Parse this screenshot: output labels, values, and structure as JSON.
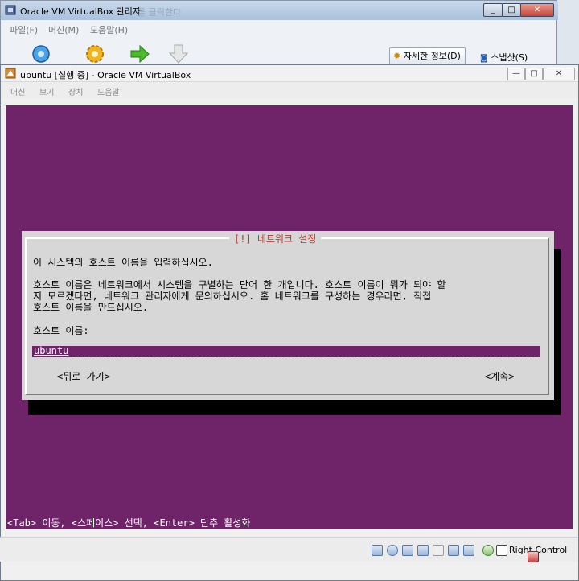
{
  "manager": {
    "title": "Oracle VM VirtualBox 관리자",
    "faded_hint": "을 클릭한다",
    "menu": [
      "파일(F)",
      "머신(M)",
      "도움말(H)"
    ],
    "toolbar": {
      "details_label": "자세한 정보(D)",
      "snapshots_label": "스냅샷(S)"
    },
    "win_controls": {
      "minimize": "_",
      "maximize": "□",
      "close": "✕"
    }
  },
  "vm": {
    "title": "ubuntu [실행 중] - Oracle VM VirtualBox",
    "menu": [
      "머신",
      "보기",
      "장치",
      "도움말"
    ],
    "win_controls": {
      "minimize": "—",
      "maximize": "□",
      "close": "✕"
    }
  },
  "installer": {
    "dialog_title": "[!] 네트워크 설정",
    "prompt": "이 시스템의 호스트 이름을 입력하십시오.",
    "description": [
      "호스트 이름은 네트워크에서 시스템을 구별하는 단어 한 개입니다. 호스트 이름이 뭐가 되야 할",
      "지 모르겠다면, 네트워크 관리자에게 문의하십시오. 홈 네트워크를 구성하는 경우라면, 직접",
      "호스트 이름을 만드십시오."
    ],
    "field_label": "호스트 이름:",
    "hostname_value": "ubuntu",
    "back_button": "<뒤로 가기>",
    "continue_button": "<계속>",
    "help_line": "<Tab> 이동, <스페이스> 선택, <Enter> 단추 활성화"
  },
  "statusbar": {
    "host_key": "Right Control"
  },
  "colors": {
    "console_background": "#6f246a",
    "dialog_background": "#d7d7d7",
    "dialog_title_text": "#c0392b"
  }
}
